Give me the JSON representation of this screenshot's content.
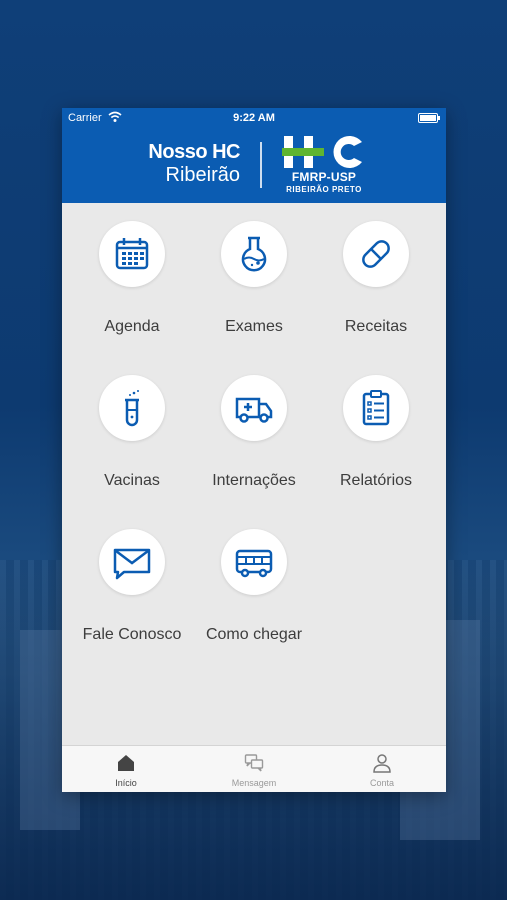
{
  "status_bar": {
    "carrier": "Carrier",
    "time": "9:22 AM"
  },
  "header": {
    "title_line1": "Nosso HC",
    "title_line2": "Ribeirão"
  },
  "logo": {
    "mark": "HC",
    "line1": "FMRP-USP",
    "line2": "RIBEIRÃO PRETO"
  },
  "menu": [
    {
      "label": "Agenda",
      "icon": "calendar-icon"
    },
    {
      "label": "Exames",
      "icon": "flask-icon"
    },
    {
      "label": "Receitas",
      "icon": "pill-icon"
    },
    {
      "label": "Vacinas",
      "icon": "test-tube-icon"
    },
    {
      "label": "Internações",
      "icon": "ambulance-icon"
    },
    {
      "label": "Relatórios",
      "icon": "clipboard-icon"
    },
    {
      "label": "Fale Conosco",
      "icon": "envelope-icon"
    },
    {
      "label": "Como chegar",
      "icon": "bus-icon"
    }
  ],
  "tabs": [
    {
      "label": "Início",
      "icon": "home-icon",
      "active": true
    },
    {
      "label": "Mensagem",
      "icon": "chat-icon",
      "active": false
    },
    {
      "label": "Conta",
      "icon": "user-icon",
      "active": false
    }
  ],
  "colors": {
    "brand_blue": "#0b5cb2",
    "icon_blue": "#0b5cb2",
    "logo_green": "#5fb531"
  }
}
